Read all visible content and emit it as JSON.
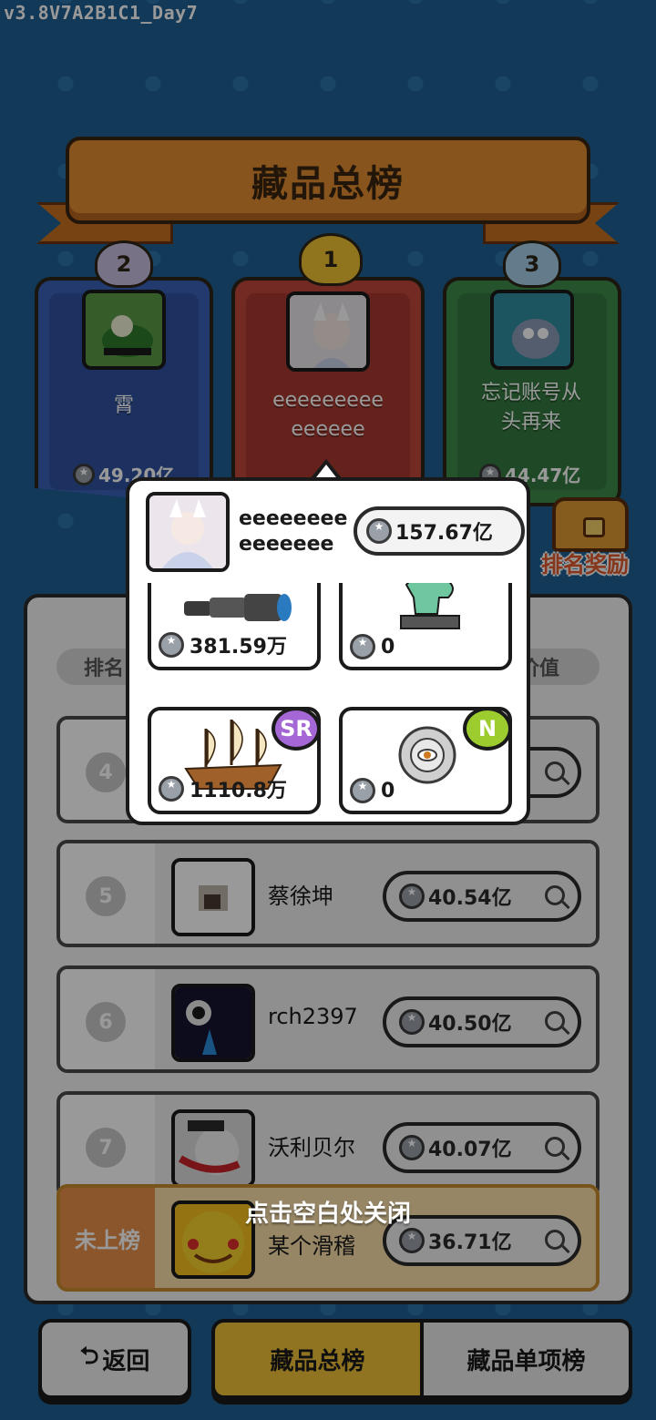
{
  "version": "v3.8V7A2B1C1_Day7",
  "title": "藏品总榜",
  "podium": [
    {
      "rank": "2",
      "name": "霄",
      "value": "49.20亿"
    },
    {
      "rank": "1",
      "name_line1": "eeeeeeeee",
      "name_line2": "eeeeee",
      "value": ""
    },
    {
      "rank": "3",
      "name_line1": "忘记账号从",
      "name_line2": "头再来",
      "value": "44.47亿"
    }
  ],
  "rank_reward_label": "排名奖励",
  "columns": {
    "rank": "排名",
    "value": "价值"
  },
  "rows": [
    {
      "rank": "4",
      "name": "",
      "value": ""
    },
    {
      "rank": "5",
      "name": "蔡徐坤",
      "value": "40.54亿"
    },
    {
      "rank": "6",
      "name": "rch2397",
      "value": "40.50亿"
    },
    {
      "rank": "7",
      "name": "沃利贝尔",
      "value": "40.07亿"
    }
  ],
  "my_row": {
    "rank": "未上榜",
    "name": "某个滑稽",
    "value": "36.71亿"
  },
  "close_hint": "点击空白处关闭",
  "popup": {
    "name_line1": "eeeeeeee",
    "name_line2": "eeeeeee",
    "value": "157.67亿",
    "items": [
      {
        "name": "telescope-item",
        "value": "381.59万",
        "rarity": ""
      },
      {
        "name": "jade-horse-item",
        "value": "0",
        "rarity": ""
      },
      {
        "name": "sailing-ship-item",
        "value": "1110.8万",
        "rarity": "SR"
      },
      {
        "name": "eye-coin-item",
        "value": "0",
        "rarity": "N"
      }
    ]
  },
  "nav": {
    "back": "返回",
    "tab_total": "藏品总榜",
    "tab_single": "藏品单项榜"
  },
  "colors": {
    "background": "#1e5f91",
    "gold_tab": "#f2c13a",
    "rank2": "#3a62b8",
    "rank1": "#c0463b",
    "rank3": "#3f8a4a",
    "sr": "#a566d6",
    "n": "#9ccc2e"
  }
}
